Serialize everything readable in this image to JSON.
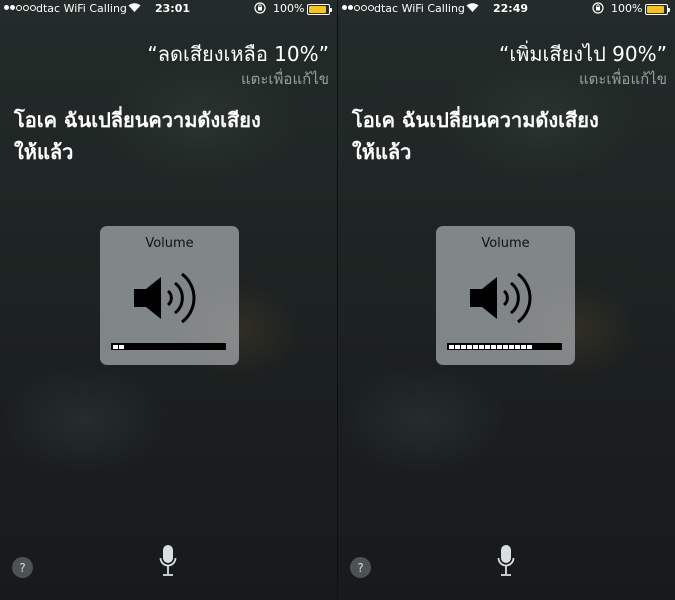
{
  "screens": [
    {
      "status": {
        "carrier": "dtac WiFi Calling",
        "time": "23:01",
        "battery_percent": "100%",
        "battery_level": 1.0
      },
      "query": "“ลดเสียงเหลือ 10%”",
      "tap_to_edit": "แตะเพื่อแก้ไข",
      "response_line1": "โอเค ฉันเปลี่ยนความดังเสียง",
      "response_line2": "ให้แล้ว",
      "volume": {
        "title": "Volume",
        "level": 0.1
      }
    },
    {
      "status": {
        "carrier": "dtac WiFi Calling",
        "time": "22:49",
        "battery_percent": "100%",
        "battery_level": 1.0
      },
      "query": "“เพิ่มเสียงไป 90%”",
      "tap_to_edit": "แตะเพื่อแก้ไข",
      "response_line1": "โอเค ฉันเปลี่ยนความดังเสียง",
      "response_line2": "ให้แล้ว",
      "volume": {
        "title": "Volume",
        "level": 0.9
      }
    }
  ],
  "help_label": "?",
  "icons": {
    "wifi": "wifi-icon",
    "rotation_lock": "rotation-lock-icon",
    "speaker": "speaker-icon",
    "mic": "microphone-icon"
  },
  "colors": {
    "battery": "#f5c518",
    "hud": "#bec4c8",
    "tap_to_edit": "#8fa09a"
  }
}
